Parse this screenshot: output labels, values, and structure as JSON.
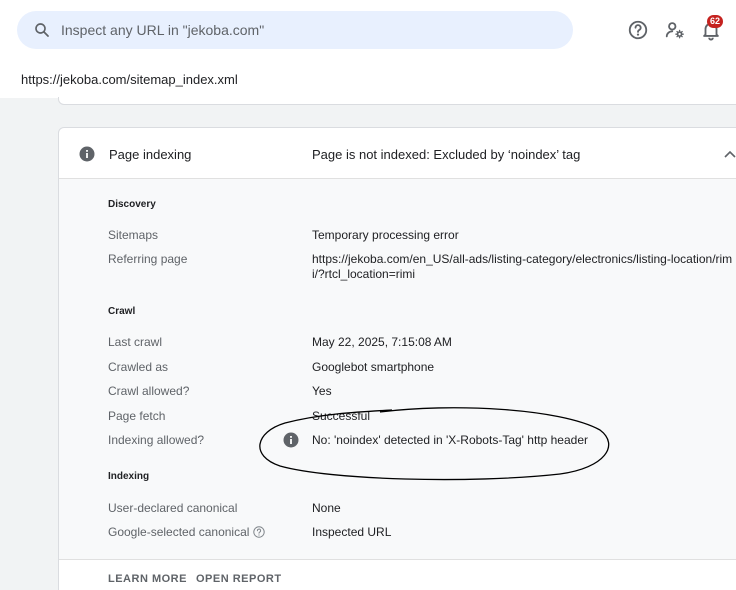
{
  "search": {
    "placeholder": "Inspect any URL in \"jekoba.com\""
  },
  "header": {
    "notification_count": "62"
  },
  "inspected_url": "https://jekoba.com/sitemap_index.xml",
  "card": {
    "title": "Page indexing",
    "status": "Page is not indexed: Excluded by ‘noindex’ tag",
    "discovery": {
      "heading": "Discovery",
      "rows": [
        {
          "label": "Sitemaps",
          "value": "Temporary processing error"
        },
        {
          "label": "Referring page",
          "value_line1": "https://jekoba.com/en_US/all-ads/listing-category/electronics/listing-location/rim",
          "value_line2": "i/?rtcl_location=rimi"
        }
      ]
    },
    "crawl": {
      "heading": "Crawl",
      "rows": [
        {
          "label": "Last crawl",
          "value": "May 22, 2025, 7:15:08 AM"
        },
        {
          "label": "Crawled as",
          "value": "Googlebot smartphone"
        },
        {
          "label": "Crawl allowed?",
          "value": "Yes"
        },
        {
          "label": "Page fetch",
          "value": "Successful"
        },
        {
          "label": "Indexing allowed?",
          "value": "No: 'noindex' detected in 'X-Robots-Tag' http header"
        }
      ]
    },
    "indexing": {
      "heading": "Indexing",
      "rows": [
        {
          "label": "User-declared canonical",
          "value": "None"
        },
        {
          "label": "Google-selected canonical",
          "value": "Inspected URL"
        }
      ]
    },
    "actions": {
      "learn_more": "LEARN MORE",
      "open_report": "OPEN REPORT"
    }
  },
  "colors": {
    "search_bg": "#e8f0fe",
    "badge": "#c5221f",
    "page_bg": "#f1f3f4",
    "annotation": "#000000"
  }
}
